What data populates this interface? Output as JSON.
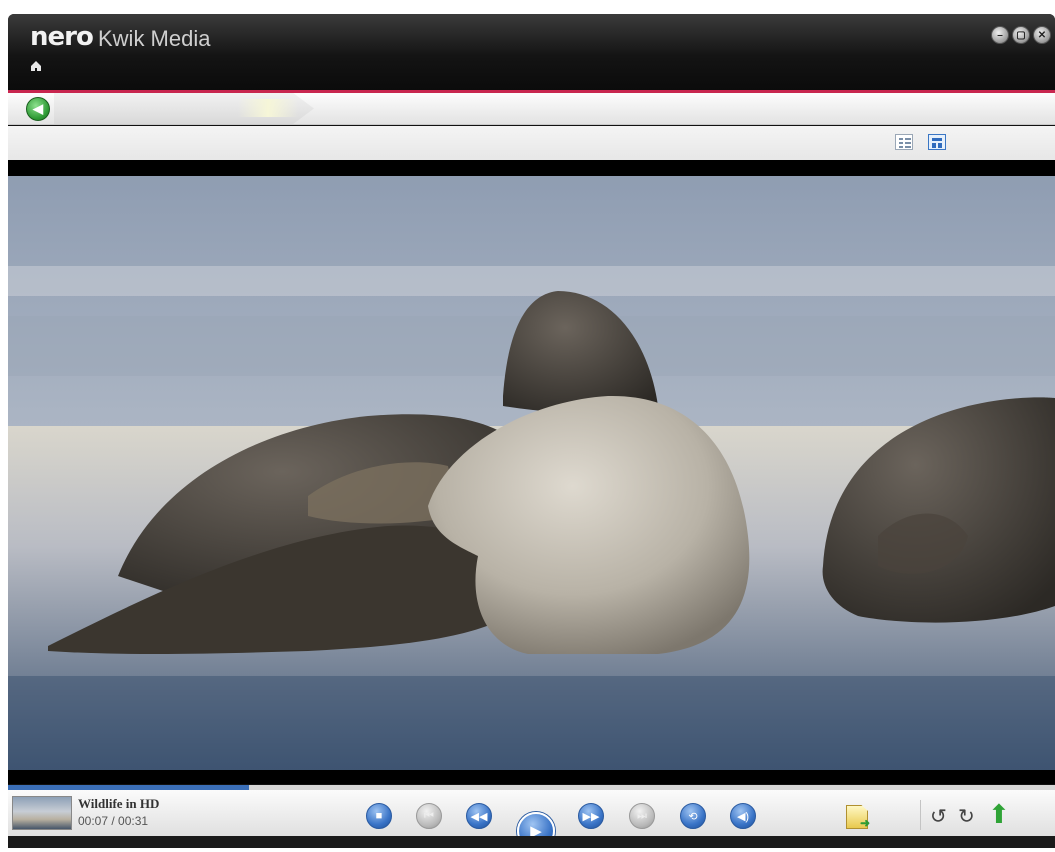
{
  "app": {
    "brand": "nero",
    "title": "Kwik Media"
  },
  "window_controls": {
    "minimize_icon": "minimize-icon",
    "restore_icon": "restore-icon",
    "close_icon": "close-icon"
  },
  "colors": {
    "accent_red": "#c8264f",
    "play_blue": "#3a74c7",
    "back_green": "#2e9b35"
  },
  "view_modes": {
    "selected": "thumbnail"
  },
  "player": {
    "media_title": "Wildlife in HD",
    "time": "00:07 / 00:31",
    "progress": 0.23
  },
  "controls": [
    {
      "name": "stop",
      "icon": "stop-icon",
      "enabled": true
    },
    {
      "name": "previous",
      "icon": "skip-back-icon",
      "enabled": false
    },
    {
      "name": "rewind",
      "icon": "rewind-icon",
      "enabled": true
    },
    {
      "name": "play",
      "icon": "play-icon",
      "enabled": true
    },
    {
      "name": "fast-forward",
      "icon": "fast-forward-icon",
      "enabled": true
    },
    {
      "name": "next",
      "icon": "skip-forward-icon",
      "enabled": false
    },
    {
      "name": "repeat",
      "icon": "repeat-icon",
      "enabled": true
    },
    {
      "name": "volume",
      "icon": "volume-icon",
      "enabled": true
    }
  ]
}
